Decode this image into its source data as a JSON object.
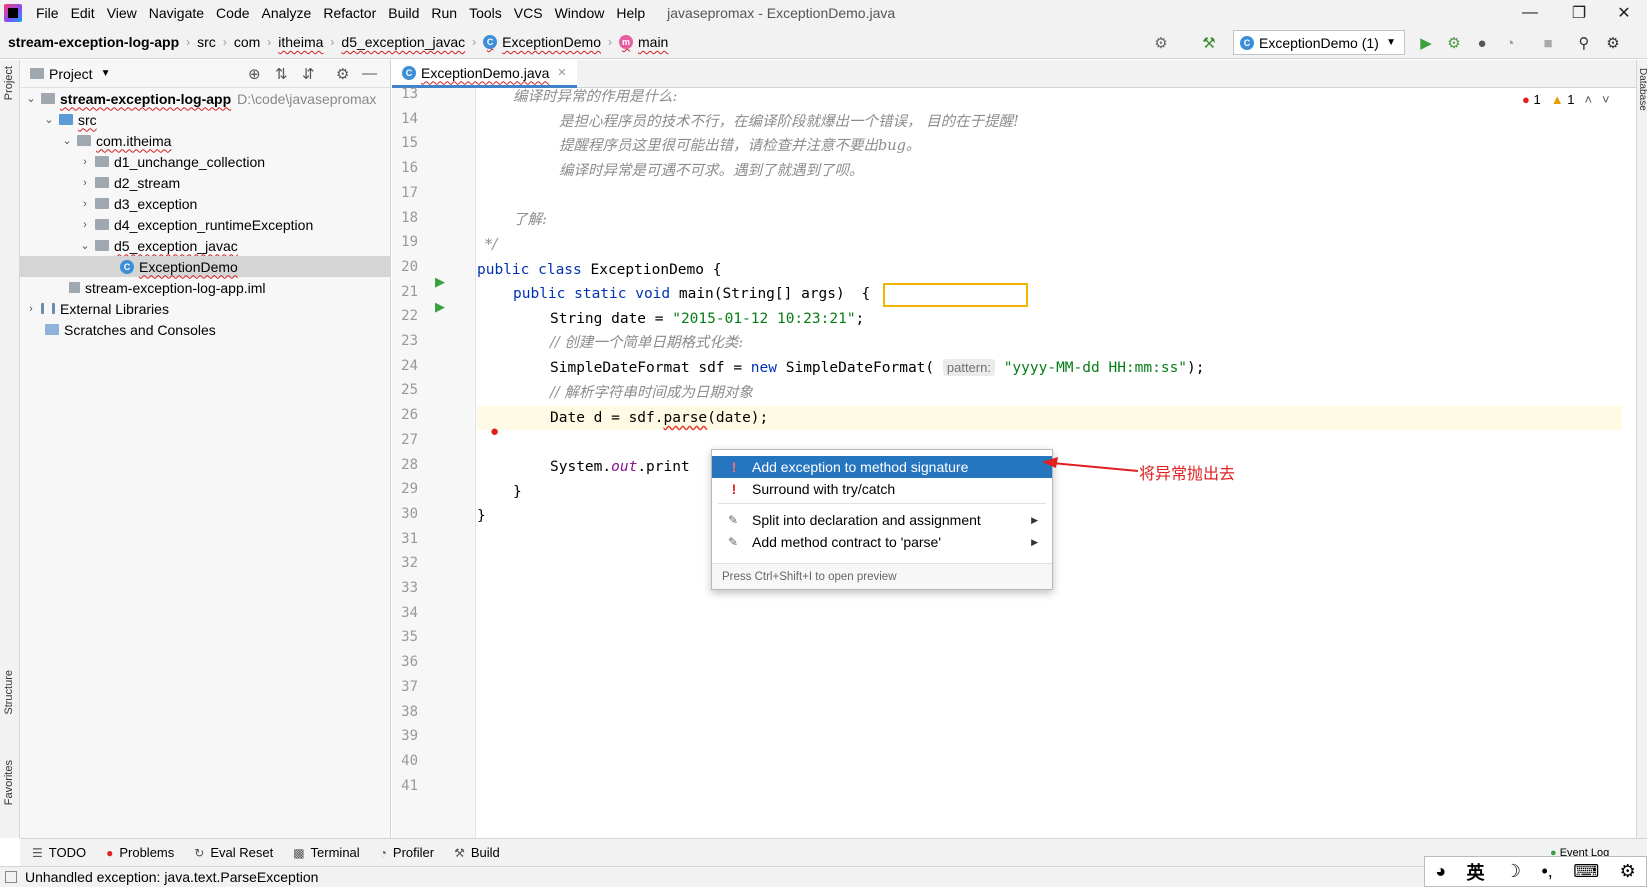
{
  "menubar": {
    "items": [
      "File",
      "Edit",
      "View",
      "Navigate",
      "Code",
      "Analyze",
      "Refactor",
      "Build",
      "Run",
      "Tools",
      "VCS",
      "Window",
      "Help"
    ],
    "window_title": "javasepromax - ExceptionDemo.java"
  },
  "navbar": {
    "project": "stream-exception-log-app",
    "crumbs": [
      "src",
      "com",
      "itheima",
      "d5_exception_javac"
    ],
    "class_name": "ExceptionDemo",
    "method_name": "main",
    "run_config": "ExceptionDemo (1)"
  },
  "project_panel": {
    "title": "Project",
    "tree": [
      {
        "label": "stream-exception-log-app",
        "path": "D:\\code\\javasepromax"
      },
      {
        "label": "src"
      },
      {
        "label": "com.itheima"
      },
      {
        "label": "d1_unchange_collection"
      },
      {
        "label": "d2_stream"
      },
      {
        "label": "d3_exception"
      },
      {
        "label": "d4_exception_runtimeException"
      },
      {
        "label": "d5_exception_javac"
      },
      {
        "label": "ExceptionDemo"
      },
      {
        "label": "stream-exception-log-app.iml"
      },
      {
        "label": "External Libraries"
      },
      {
        "label": "Scratches and Consoles"
      }
    ]
  },
  "editor": {
    "tab": "ExceptionDemo.java",
    "problems": {
      "errors": "1",
      "warnings": "1"
    },
    "line_numbers": [
      "13",
      "14",
      "15",
      "16",
      "17",
      "18",
      "19",
      "20",
      "21",
      "22",
      "23",
      "24",
      "25",
      "26",
      "27",
      "28",
      "29",
      "30",
      "31",
      "32",
      "33",
      "34",
      "35",
      "36",
      "37",
      "38",
      "39",
      "40",
      "41"
    ],
    "code": {
      "l13": "编译时异常的作用是什么:",
      "l14": "是担心程序员的技术不行，在编译阶段就爆出一个错误， 目的在于提醒!",
      "l15": "提醒程序员这里很可能出错，请检查并注意不要出bug。",
      "l16": "编译时异常是可遇不可求。遇到了就遇到了呗。",
      "l18": "了解:",
      "l19": "*/",
      "l20_kw": "public class",
      "l20_rest": " ExceptionDemo {",
      "l21_kw": "public static void",
      "l21_rest": " main(String[] args) ",
      "l21_brace": "{",
      "l22_a": "String date = ",
      "l22_str": "\"2015-01-12 10:23:21\"",
      "l22_b": ";",
      "l23": "// 创建一个简单日期格式化类:",
      "l24_a": "SimpleDateFormat sdf = ",
      "l24_kw": "new",
      "l24_b": " SimpleDateFormat(",
      "l24_hint": "pattern:",
      "l24_str": "\"yyyy-MM-dd HH:mm:ss\"",
      "l24_c": ");",
      "l25": "// 解析字符串时间成为日期对象",
      "l26_a": "Date d = sdf.",
      "l26_err": "parse",
      "l26_b": "(date);",
      "l28_a": "System.",
      "l28_fld": "out",
      "l28_b": ".print",
      "l29": "}",
      "l30": "}"
    }
  },
  "popup": {
    "items": [
      {
        "label": "Add exception to method signature",
        "icon": "error-bulb-icon"
      },
      {
        "label": "Surround with try/catch",
        "icon": "error-bulb-icon"
      },
      {
        "label": "Split into declaration and assignment",
        "icon": "pen-icon"
      },
      {
        "label": "Add method contract to 'parse'",
        "icon": "pen-icon"
      }
    ],
    "footer": "Press Ctrl+Shift+I to open preview"
  },
  "annotation": "将异常抛出去",
  "left_strip": {
    "project": "Project",
    "structure": "Structure",
    "favorites": "Favorites"
  },
  "right_strip": {
    "database": "Database"
  },
  "bottom_tools": [
    "TODO",
    "Problems",
    "Eval Reset",
    "Terminal",
    "Profiler",
    "Build"
  ],
  "event_log": "Event Log",
  "status": "Unhandled exception: java.text.ParseException",
  "ime": {
    "lang": "英"
  },
  "colors": {
    "accent": "#2675bf",
    "error": "#e02020",
    "highlight_box": "#f5b400",
    "keyword": "#0033b3",
    "string": "#067d17"
  }
}
